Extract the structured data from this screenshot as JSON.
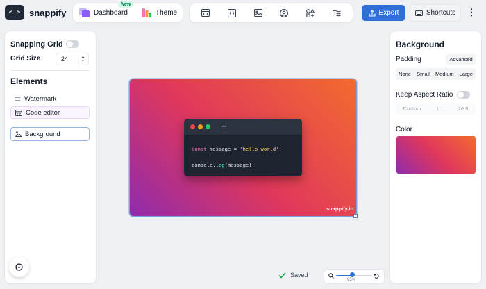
{
  "app": {
    "name": "snappify",
    "logo_glyph": "< >"
  },
  "nav": {
    "dashboard_label": "Dashboard",
    "dashboard_badge": "New",
    "theme_label": "Theme"
  },
  "toolbar": {
    "tools": [
      "code-window-icon",
      "code-braces-icon",
      "image-icon",
      "user-circle-icon",
      "shapes-icon",
      "waves-icon"
    ],
    "export_label": "Export",
    "shortcuts_label": "Shortcuts"
  },
  "left": {
    "snapping_grid_label": "Snapping Grid",
    "snapping_grid_on": false,
    "grid_size_label": "Grid Size",
    "grid_size_value": "24",
    "elements_title": "Elements",
    "elements": [
      {
        "label": "Watermark",
        "icon": "watermark-lines-icon"
      },
      {
        "label": "Code editor",
        "icon": "code-editor-icon"
      },
      {
        "label": "Background",
        "icon": "image-landscape-icon"
      }
    ]
  },
  "canvas": {
    "code_lines": [
      {
        "kw": "const",
        "name": " message = ",
        "str": "'hello world'",
        "end": ";"
      },
      {
        "obj": "console.",
        "fn": "log",
        "args": "(message);"
      }
    ],
    "watermark": "snappify.io",
    "gradient_colors": [
      "#8f2bad",
      "#e0375c",
      "#f26b2e"
    ]
  },
  "status": {
    "saved_label": "Saved",
    "zoom_label": "95%",
    "zoom_level": 0.95
  },
  "right": {
    "title": "Background",
    "padding_label": "Padding",
    "advanced_label": "Advanced",
    "padding_options": [
      "None",
      "Small",
      "Medium",
      "Large"
    ],
    "aspect_label": "Keep Aspect Ratio",
    "aspect_on": false,
    "aspect_options": [
      "Custom",
      "1:1",
      "16:9"
    ],
    "color_label": "Color"
  },
  "colors": {
    "accent": "#2f6fd6",
    "code_bg": "#1e2430",
    "dot_red": "#ef4444",
    "dot_yellow": "#f59e0b",
    "dot_green": "#22c55e"
  }
}
